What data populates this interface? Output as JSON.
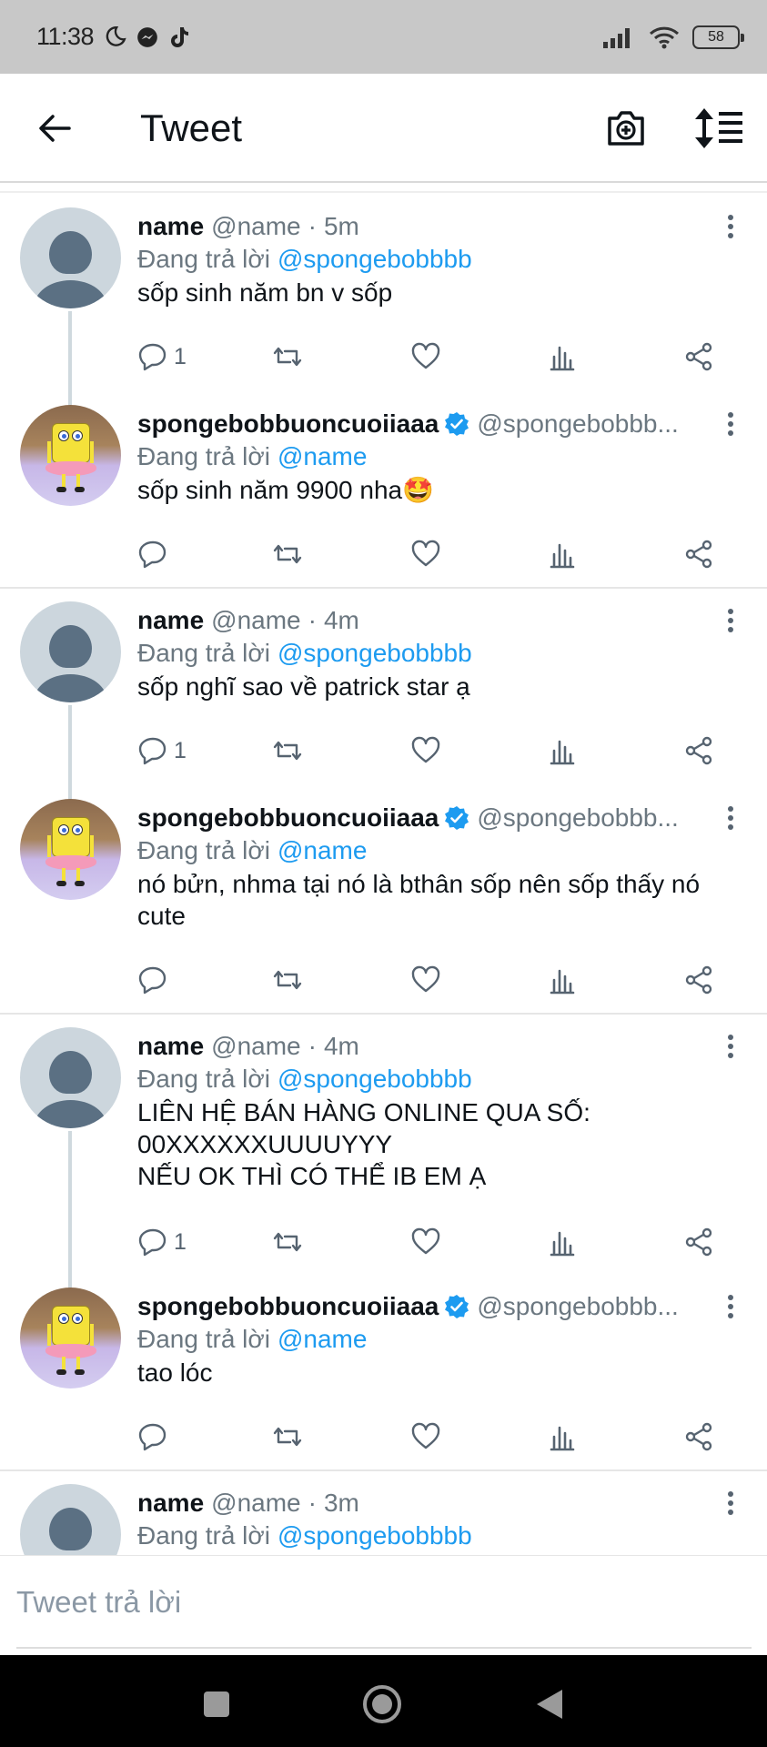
{
  "status_bar": {
    "time": "11:38",
    "battery": "58",
    "battery_level": 0.58
  },
  "header": {
    "title": "Tweet"
  },
  "tweets": [
    {
      "name": "name",
      "handle": "@name",
      "time": "5m",
      "reply_label": "Đang trả lời",
      "reply_to": "@spongebobbbb",
      "text": "sốp sinh năm bn v sốp",
      "reply_count": "1",
      "avatar": "default"
    },
    {
      "name": "spongebobbuoncuoiiaaa",
      "handle": "@spongebobbb...",
      "verified": true,
      "reply_label": "Đang trả lời",
      "reply_to": "@name",
      "text": "sốp sinh năm 9900 nha🤩",
      "reply_count": "",
      "avatar": "spongebob"
    },
    {
      "name": "name",
      "handle": "@name",
      "time": "4m",
      "reply_label": "Đang trả lời",
      "reply_to": "@spongebobbbb",
      "text": "sốp nghĩ sao về patrick star ạ",
      "reply_count": "1",
      "avatar": "default"
    },
    {
      "name": "spongebobbuoncuoiiaaa",
      "handle": "@spongebobbb...",
      "verified": true,
      "reply_label": "Đang trả lời",
      "reply_to": "@name",
      "text": "nó bửn, nhma tại nó là bthân sốp nên sốp thấy nó cute",
      "reply_count": "",
      "avatar": "spongebob"
    },
    {
      "name": "name",
      "handle": "@name",
      "time": "4m",
      "reply_label": "Đang trả lời",
      "reply_to": "@spongebobbbb",
      "text": "LIÊN HỆ BÁN HÀNG ONLINE QUA SỐ:\n00XXXXXXUUUUYYY\nNẾU OK THÌ CÓ THỂ IB EM Ạ",
      "reply_count": "1",
      "avatar": "default"
    },
    {
      "name": "spongebobbuoncuoiiaaa",
      "handle": "@spongebobbb...",
      "verified": true,
      "reply_label": "Đang trả lời",
      "reply_to": "@name",
      "text": "tao lóc",
      "reply_count": "",
      "avatar": "spongebob"
    },
    {
      "name": "name",
      "handle": "@name",
      "time": "3m",
      "reply_label": "Đang trả lời",
      "reply_to": "@spongebobbbb",
      "text": "",
      "reply_count": "",
      "avatar": "default"
    }
  ],
  "separator": "·",
  "composer": {
    "placeholder": "Tweet trả lời"
  },
  "colors": {
    "accent": "#1d9bf0",
    "verified": "#1d9bf0",
    "muted_text": "#6b7780",
    "status_bar_bg": "#c8c8c8",
    "nav_bar_bg": "#000000"
  },
  "icons": {
    "back": "arrow-left-icon",
    "camera": "camera-plus-icon",
    "sort": "sort-icon",
    "reply": "reply-icon",
    "retweet": "retweet-icon",
    "like": "heart-icon",
    "views": "views-icon",
    "share": "share-icon",
    "more": "more-vertical-icon"
  }
}
